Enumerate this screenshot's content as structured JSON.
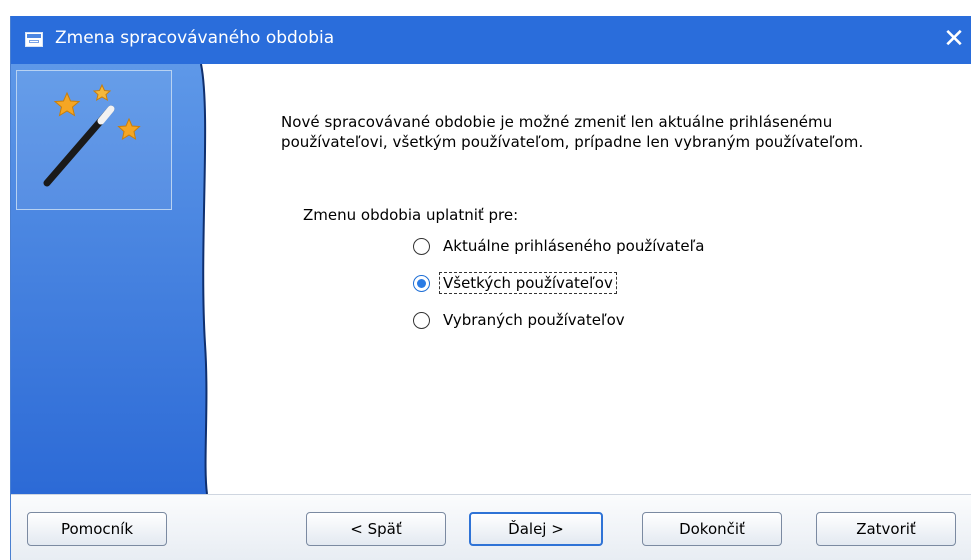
{
  "window": {
    "title": "Zmena spracovávaného obdobia",
    "close_glyph": "✕",
    "accent_color": "#2a6ddb"
  },
  "icons": {
    "app": "window-icon",
    "wizard": "magic-wand-icon"
  },
  "description": {
    "line1": "Nové spracovávané obdobie je možné zmeniť len aktuálne prihlásenému",
    "line2": "používateľovi, všetkým používateľom, prípadne len vybraným používateľom."
  },
  "group_label": "Zmenu obdobia uplatniť pre:",
  "options": [
    {
      "label": "Aktuálne prihláseného používateľa",
      "checked": false
    },
    {
      "label": "Všetkých používateľov",
      "checked": true
    },
    {
      "label": "Vybraných používateľov",
      "checked": false
    }
  ],
  "buttons": {
    "help": "Pomocník",
    "back": "< Späť",
    "next": "Ďalej >",
    "finish": "Dokončiť",
    "close": "Zatvoriť"
  }
}
